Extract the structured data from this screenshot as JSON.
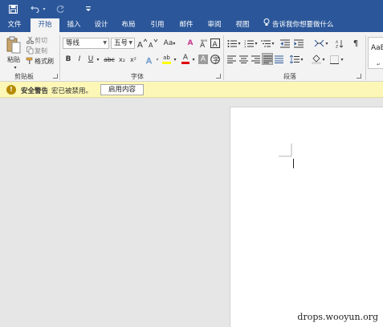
{
  "qat": {
    "save_icon": "save-icon",
    "undo_icon": "undo-icon",
    "redo_icon": "redo-icon",
    "customize_icon": "customize-qat-icon"
  },
  "tabs": [
    {
      "label": "文件",
      "active": false
    },
    {
      "label": "开始",
      "active": true
    },
    {
      "label": "插入",
      "active": false
    },
    {
      "label": "设计",
      "active": false
    },
    {
      "label": "布局",
      "active": false
    },
    {
      "label": "引用",
      "active": false
    },
    {
      "label": "邮件",
      "active": false
    },
    {
      "label": "审阅",
      "active": false
    },
    {
      "label": "视图",
      "active": false
    }
  ],
  "tell_me": "告诉我你想要做什么",
  "clipboard": {
    "paste": "粘贴",
    "cut": "剪切",
    "copy": "复制",
    "format_painter": "格式刷",
    "group_label": "剪贴板"
  },
  "font": {
    "font_name": "等线",
    "font_size": "五号",
    "group_label": "字体",
    "change_case": "Aa",
    "clear_format": "A",
    "bold": "B",
    "italic": "I",
    "underline": "U",
    "strike": "abc",
    "subscript": "x₂",
    "superscript": "x²",
    "font_color_letter": "A",
    "highlight_letters": "ab",
    "char_shading_letter": "A"
  },
  "paragraph": {
    "group_label": "段落"
  },
  "styles": {
    "preview": "AaBb"
  },
  "security": {
    "title": "安全警告",
    "message": "宏已被禁用。",
    "button": "启用内容"
  },
  "watermark": "drops.wooyun.org",
  "colors": {
    "ribbon_blue": "#2b579a",
    "ribbon_bg": "#f3f3f3",
    "warning_bg": "#fcf7b6",
    "font_color_red": "#e00000",
    "highlight_yellow": "#ffff00"
  }
}
